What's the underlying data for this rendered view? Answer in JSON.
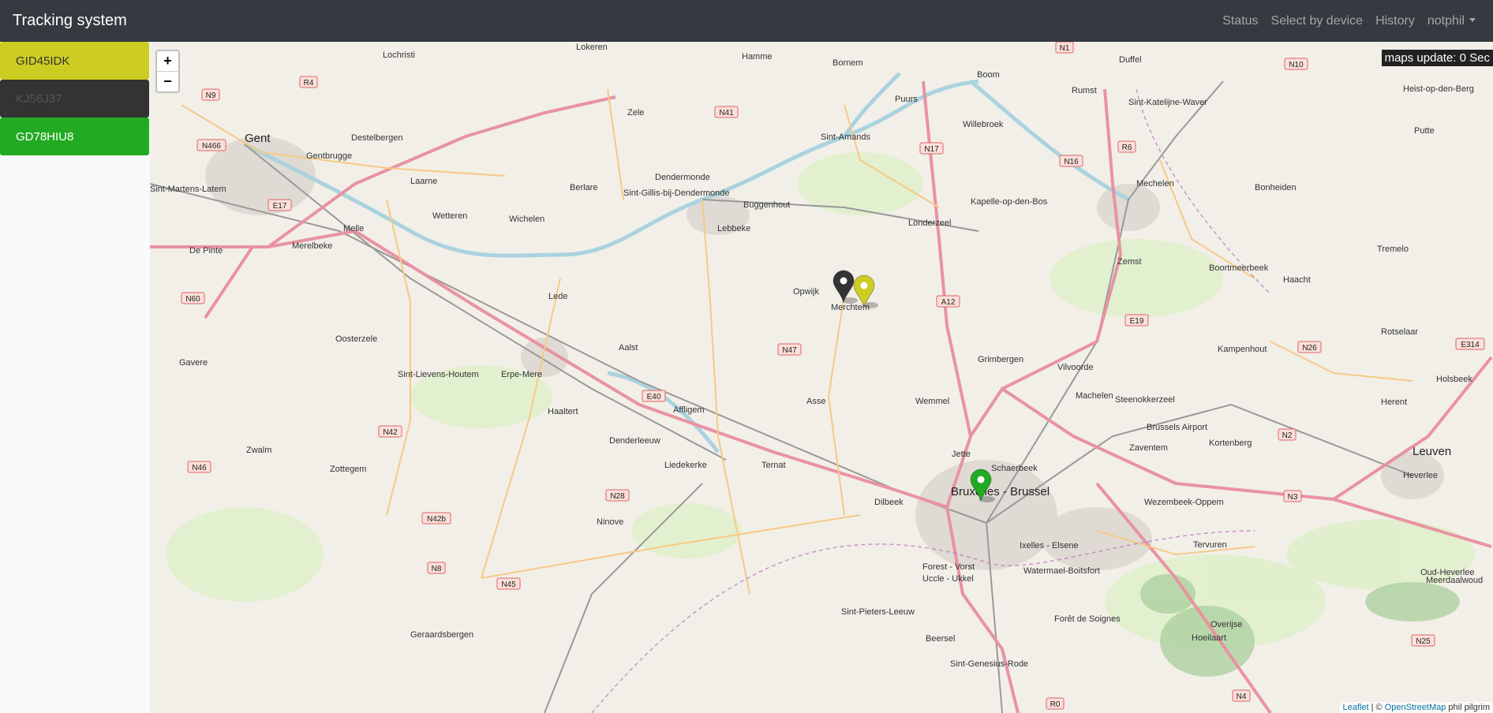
{
  "navbar": {
    "brand": "Tracking system",
    "links": [
      "Status",
      "Select by device",
      "History",
      "notphil"
    ]
  },
  "devices": [
    {
      "label": "GID45IDK",
      "bg": "#cccc22",
      "fg": "#333333"
    },
    {
      "label": "KJ56J37",
      "bg": "#333333",
      "fg": "#555555"
    },
    {
      "label": "GD78HIU8",
      "bg": "#22aa22",
      "fg": "#ffffff"
    }
  ],
  "map": {
    "zoom_in": "+",
    "zoom_out": "−",
    "update_text": "maps update: 0 Sec",
    "attribution": {
      "leaflet": "Leaflet",
      "sep": " | © ",
      "osm": "OpenStreetMap",
      "author": " phil pilgrim"
    },
    "places": [
      "Gent",
      "Lokeren",
      "Lochristi",
      "Destelbergen",
      "Gentbrugge",
      "Laarne",
      "Melle",
      "Merelbeke",
      "De Pinte",
      "Sint-Martens-Latem",
      "Hamme",
      "Zele",
      "Bornem",
      "Puurs",
      "Boom",
      "Rumst",
      "Duffel",
      "Sint-Katelijne-Waver",
      "Heist-op-den-Berg",
      "Putte",
      "Mechelen",
      "Bonheiden",
      "Sint-Amands",
      "Willebroek",
      "Dendermonde",
      "Sint-Gillis-bij-Dendermonde",
      "Buggenhout",
      "Berlare",
      "Wetteren",
      "Wichelen",
      "Lebbeke",
      "Londerzeel",
      "Kapelle-op-den-Bos",
      "Zemst",
      "Boortmeerbeek",
      "Haacht",
      "Tremelo",
      "Opwijk",
      "Merchtem",
      "Lede",
      "Oosterzele",
      "Gavere",
      "Aalst",
      "Erpe-Mere",
      "Sint-Lievens-Houtem",
      "Haaltert",
      "Affligem",
      "Asse",
      "Wemmel",
      "Grimbergen",
      "Vilvoorde",
      "Machelen",
      "Steenokkerzeel",
      "Kampenhout",
      "Rotselaar",
      "Holsbeek",
      "Herent",
      "Leuven",
      "Heverlee",
      "Kortenberg",
      "Zaventem",
      "Denderleeuw",
      "Liedekerke",
      "Ternat",
      "Jette",
      "Schaerbeek",
      "Bruxelles - Brussel",
      "Dilbeek",
      "Zwalm",
      "Zottegem",
      "Ninove",
      "Wezembeek-Oppem",
      "Tervuren",
      "Oud-Heverlee",
      "Ixelles - Elsene",
      "Forest - Vorst",
      "Uccle - Ukkel",
      "Sint-Pieters-Leeuw",
      "Watermael-Boitsfort",
      "Overijse",
      "Hoeilaart",
      "Beersel",
      "Sint-Genesius-Rode",
      "Geraardsbergen",
      "Meerdaalwoud",
      "Brussels Airport",
      "Forêt de Soignes"
    ],
    "roads": [
      "N9",
      "R4",
      "N466",
      "E17",
      "N60",
      "N41",
      "N17",
      "N16",
      "R6",
      "N10",
      "A12",
      "E19",
      "N47",
      "E40",
      "N42",
      "N46",
      "N28",
      "N42b",
      "N8",
      "N45",
      "N2",
      "N3",
      "N26",
      "E314",
      "N25",
      "R0",
      "N4",
      "N1"
    ]
  },
  "markers": [
    {
      "device": "KJ56J37",
      "color": "#333333"
    },
    {
      "device": "GID45IDK",
      "color": "#cccc22"
    },
    {
      "device": "GD78HIU8",
      "color": "#22aa22"
    }
  ]
}
